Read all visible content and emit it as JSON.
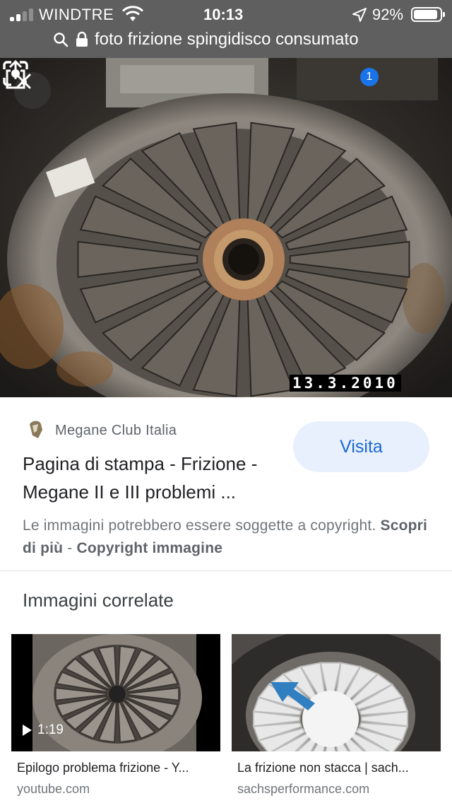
{
  "status_bar": {
    "carrier": "WINDTRE",
    "time": "10:13",
    "battery_percent": "92%",
    "battery_level": 0.92,
    "signal_bars": 2,
    "icons": [
      "signal-icon",
      "wifi-icon",
      "location-arrow-icon",
      "battery-icon"
    ]
  },
  "url_bar": {
    "query": "foto frizione spingidisco consumato",
    "icons": [
      "search-icon",
      "lock-icon"
    ]
  },
  "hero": {
    "date_stamp": "13.3.2010",
    "lens_badge": "1",
    "icons": [
      "close-icon",
      "lens-icon",
      "share-icon"
    ]
  },
  "source": {
    "site_name": "Megane Club Italia",
    "title": "Pagina di stampa - Frizione - Megane II e III problemi ...",
    "visit_label": "Visita",
    "copyright_text": "Le immagini potrebbero essere soggette a copyright.",
    "learn_more": "Scopri di più",
    "separator": "-",
    "copyright_link": "Copyright immagine"
  },
  "related": {
    "heading": "Immagini correlate",
    "items": [
      {
        "caption": "Epilogo problema frizione - Y...",
        "domain": "youtube.com",
        "duration": "1:19"
      },
      {
        "caption": "La frizione non stacca | sach...",
        "domain": "sachsperformance.com"
      }
    ]
  },
  "colors": {
    "topbar": "#5f5f5f",
    "accent": "#1a73e8",
    "visit_bg": "#e8f0fe",
    "visit_text": "#1967d2"
  }
}
